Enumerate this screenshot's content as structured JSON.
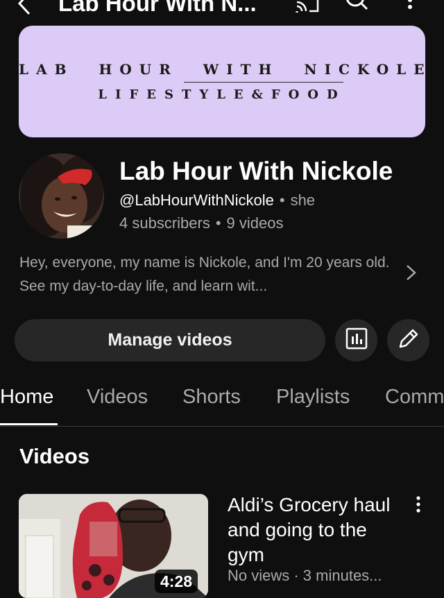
{
  "header": {
    "back_icon": "chevron-left-icon",
    "title": "Lab Hour With N...",
    "cast_icon": "cast-icon",
    "search_icon": "search-icon",
    "menu_icon": "more-vertical-icon"
  },
  "banner": {
    "line1": "LAB HOUR WITH NICKOLE",
    "line2": "LIFESTYLE&FOOD",
    "background": "#dccbf6"
  },
  "channel": {
    "name": "Lab Hour With Nickole",
    "handle": "@LabHourWithNickole",
    "separator": "•",
    "pronouns": "she",
    "subscribers": "4 subscribers",
    "videos_count": "9 videos",
    "description": "Hey, everyone, my name is Nickole, and I'm 20 years old. See my day-to-day life, and learn wit..."
  },
  "actions": {
    "manage_label": "Manage videos",
    "analytics_icon": "analytics-icon",
    "edit_icon": "pencil-icon"
  },
  "tabs": [
    {
      "label": "Home",
      "active": true
    },
    {
      "label": "Videos",
      "active": false
    },
    {
      "label": "Shorts",
      "active": false
    },
    {
      "label": "Playlists",
      "active": false
    },
    {
      "label": "Comm",
      "active": false
    }
  ],
  "section": {
    "title": "Videos"
  },
  "videos": [
    {
      "title": "Aldi’s Grocery haul and going to the gym",
      "meta": "No views · 3 minutes...",
      "duration": "4:28"
    }
  ],
  "colors": {
    "background": "#0f0f0f",
    "button": "#272727",
    "secondary_text": "#aaaaaa"
  }
}
